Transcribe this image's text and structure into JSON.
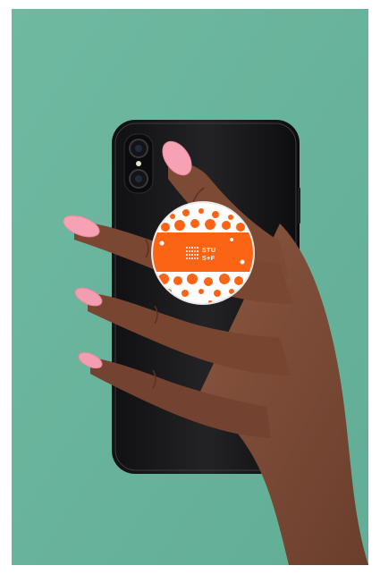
{
  "image": {
    "subject": "popsocket-product-photo",
    "background_color": "#69b49d",
    "popsocket": {
      "brand_lines": [
        "STU",
        "S+F"
      ],
      "accent_color": "#fb6415",
      "base_color": "#ffffff"
    },
    "phone_color": "#1a1a1c",
    "nail_color": "#f7a0b3",
    "skin_color": "#7a4a35"
  }
}
